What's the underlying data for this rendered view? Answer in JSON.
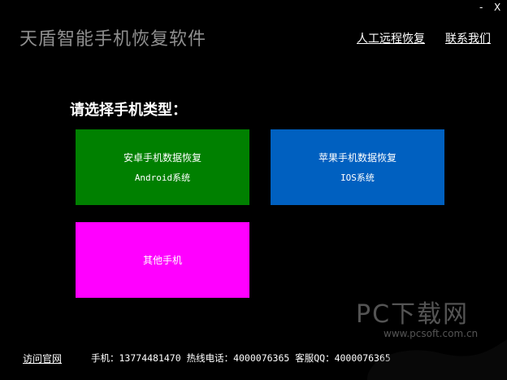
{
  "window": {
    "minimize_label": "-",
    "close_label": "X"
  },
  "header": {
    "title": "天盾智能手机恢复软件",
    "link_remote": "人工远程恢复",
    "link_contact": "联系我们"
  },
  "main": {
    "prompt": "请选择手机类型：",
    "tiles": [
      {
        "line1": "安卓手机数据恢复",
        "line2": "Android系统",
        "color": "#008000"
      },
      {
        "line1": "苹果手机数据恢复",
        "line2": "IOS系统",
        "color": "#0060c0"
      },
      {
        "line1": "其他手机",
        "line2": "",
        "color": "#ff00ff"
      }
    ]
  },
  "footer": {
    "visit_label": "访问官网",
    "contact_text": "手机：13774481470 热线电话：4000076365 客服QQ：4000076365"
  },
  "watermark": {
    "text_big": "PC下载网",
    "text_url": "www.pcsoft.com.cn"
  }
}
